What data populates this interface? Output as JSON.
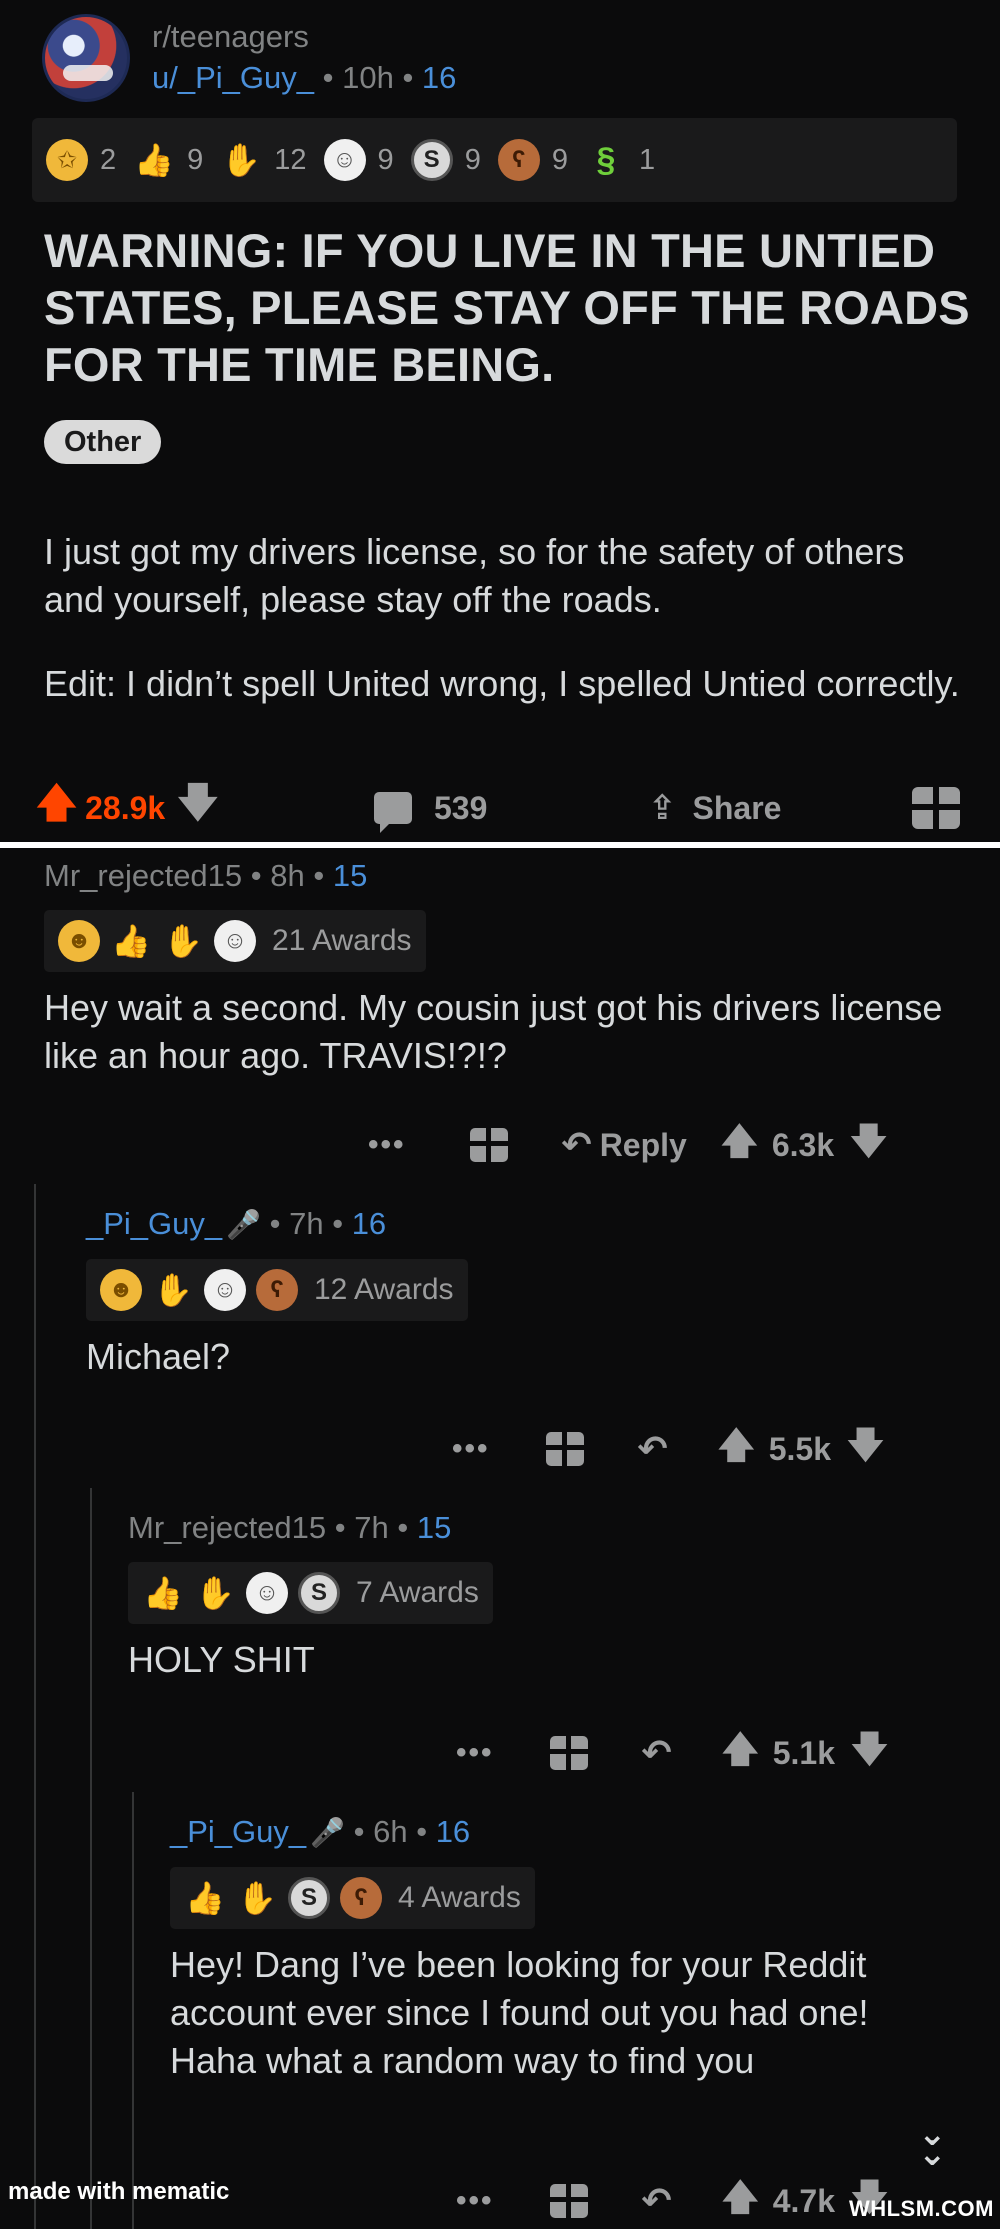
{
  "post": {
    "subreddit": "r/teenagers",
    "author": "u/_Pi_Guy_",
    "age": "10h",
    "flair_num": "16",
    "awards": [
      {
        "icon": "silver-award-icon",
        "glyph": "✩",
        "cls": "i-gold",
        "count": "2"
      },
      {
        "icon": "rocket-like-award-icon",
        "glyph": "👍",
        "cls": "i-ok",
        "count": "9"
      },
      {
        "icon": "helping-hand-award-icon",
        "glyph": "✋",
        "cls": "i-hands",
        "count": "12"
      },
      {
        "icon": "wholesome-award-icon",
        "glyph": "☺",
        "cls": "i-wholesome",
        "count": "9"
      },
      {
        "icon": "silver-s-award-icon",
        "glyph": "S",
        "cls": "i-silver",
        "count": "9"
      },
      {
        "icon": "bear-award-icon",
        "glyph": "ʕ",
        "cls": "i-bear",
        "count": "9"
      },
      {
        "icon": "snek-award-icon",
        "glyph": "§",
        "cls": "i-snek",
        "count": "1"
      }
    ],
    "title": "WARNING: IF YOU LIVE IN THE UNTIED STATES, PLEASE STAY OFF THE ROADS FOR THE TIME BEING.",
    "flair": "Other",
    "body_1": "I just got my drivers license, so for the safety of others and yourself, please stay off the roads.",
    "body_2": "Edit: I didn’t spell United wrong, I spelled Untied correctly.",
    "score": "28.9k",
    "comments_count": "539",
    "share_label": "Share"
  },
  "comments": [
    {
      "author": "Mr_rejected15",
      "age": "8h",
      "flair_num": "15",
      "awards_label": "21 Awards",
      "text": "Hey wait a second. My cousin just got his drivers license like an hour ago. TRAVIS!?!?",
      "reply_label": "Reply",
      "score": "6.3k"
    },
    {
      "author": "_Pi_Guy_",
      "age": "7h",
      "flair_num": "16",
      "awards_label": "12 Awards",
      "text": "Michael?",
      "score": "5.5k"
    },
    {
      "author": "Mr_rejected15",
      "age": "7h",
      "flair_num": "15",
      "awards_label": "7 Awards",
      "text": "HOLY SHIT",
      "score": "5.1k"
    },
    {
      "author": "_Pi_Guy_",
      "age": "6h",
      "flair_num": "16",
      "awards_label": "4 Awards",
      "text": "Hey! Dang I’ve been looking for your Reddit account ever since I found out you had one! Haha what a random way to find you",
      "score": "4.7k"
    }
  ],
  "footer": {
    "left": "made with mematic",
    "right": "WHLSM.COM"
  },
  "colors": {
    "background": "#0b0b0c",
    "upvote": "#ff4500",
    "op_blue": "#4a8fd9",
    "text": "#d7dadc",
    "muted": "#818384"
  }
}
